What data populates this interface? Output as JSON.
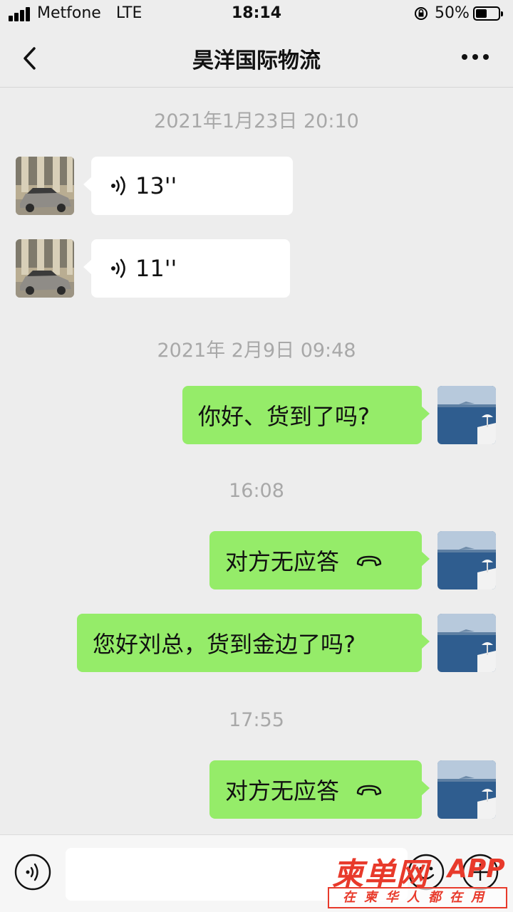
{
  "status_bar": {
    "carrier": "Metfone",
    "network": "LTE",
    "time": "18:14",
    "battery_percent": "50%",
    "battery_level": 0.5
  },
  "header": {
    "title": "昊洋国际物流",
    "back_icon": "chevron-left-icon",
    "more_icon": "more-dots-icon"
  },
  "messages": [
    {
      "type": "timestamp",
      "text": "2021年1月23日 20:10"
    },
    {
      "type": "voice",
      "direction": "received",
      "duration": "13''"
    },
    {
      "type": "voice",
      "direction": "received",
      "duration": "11''"
    },
    {
      "type": "timestamp",
      "text": "2021年 2月9日 09:48"
    },
    {
      "type": "text",
      "direction": "sent",
      "text": "你好、货到了吗?"
    },
    {
      "type": "timestamp",
      "text": "16:08"
    },
    {
      "type": "call",
      "direction": "sent",
      "text": "对方无应答"
    },
    {
      "type": "text",
      "direction": "sent",
      "text": "您好刘总，货到金边了吗?"
    },
    {
      "type": "timestamp",
      "text": "17:55"
    },
    {
      "type": "call",
      "direction": "sent",
      "text": "对方无应答"
    }
  ],
  "input_bar": {
    "text_value": "",
    "voice_icon": "voice-mode-icon",
    "emoji_icon": "emoji-icon",
    "plus_icon": "plus-icon"
  },
  "watermark": {
    "logo": "柬单网",
    "app": "APP",
    "tagline": "在柬华人都在用"
  },
  "colors": {
    "background": "#ededed",
    "sent_bubble": "#95ec69",
    "received_bubble": "#ffffff",
    "timestamp_text": "#a8a8a8",
    "watermark": "#e83a2b"
  }
}
